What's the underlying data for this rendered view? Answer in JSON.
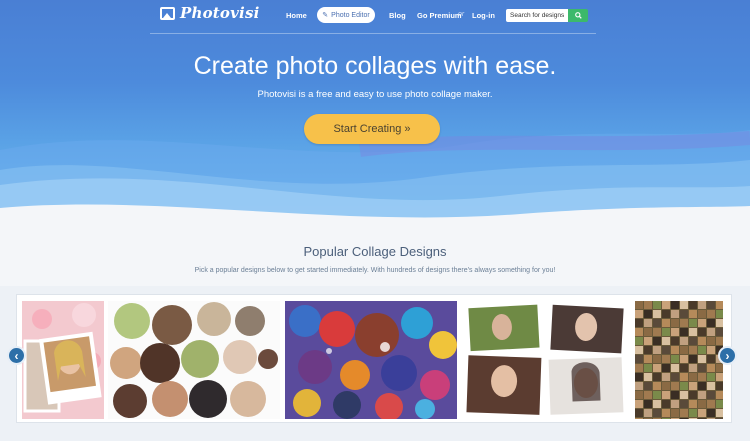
{
  "nav": {
    "brand": "Photovisi",
    "home": "Home",
    "photo_editor": "Photo Editor",
    "blog": "Blog",
    "go_premium": "Go Premium",
    "or": "or",
    "login": "Log-in",
    "search_placeholder": "Search for designs"
  },
  "hero": {
    "title": "Create photo collages with ease.",
    "subtitle": "Photovisi is a free and easy to use photo collage maker.",
    "cta": "Start Creating »"
  },
  "popular": {
    "title": "Popular Collage Designs",
    "subtitle": "Pick a popular designs below to get started immediately. With hundreds of designs there's always something for you!",
    "prev": "‹",
    "next": "›"
  },
  "colors": {
    "accent_yellow": "#f7c14a",
    "search_green": "#3cb96b",
    "arrow_blue": "#2d6fa8"
  }
}
